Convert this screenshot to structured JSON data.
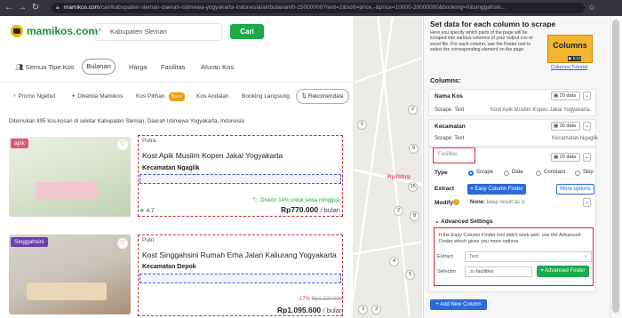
{
  "browser": {
    "url_domain": "mamikos.com",
    "url_rest": "/cari/kabupaten-sleman-daerah-istimewa-yogyakarta-indonesia/all/bulanan/0-15000000?rent=2&sort=price,-&price=10000-20000000&booking=0&singgahsin..."
  },
  "header": {
    "logo": "mamikos.com",
    "search_value": "Kabupaten Sleman",
    "search_button": "Cari"
  },
  "filters": {
    "tipe": "Semua Tipe Kos",
    "bulanan": "Bulanan",
    "harga": "Harga",
    "fasilitas": "Fasilitas",
    "aturan": "Aturan Kos"
  },
  "pills": {
    "promo": "Promo Ngebut",
    "dikelola": "Dikelola Mamikos",
    "pilihan": "Kos Pilihan",
    "baru": "Baru",
    "andalan": "Kos Andalan",
    "booking": "Booking Langsung",
    "rekomendasi": "Rekomendasi"
  },
  "found_text": "Ditemukan 895 kos-kosan di sekitar Kabupaten Sleman, Daerah Istimewa Yogyakarta, Indonesia",
  "listings": [
    {
      "tag": "apik",
      "gender": "Putra",
      "title": "Kost Apik Muslim Kopen Jakal Yogyakarta",
      "kecamatan": "Kecamatan Ngaglik",
      "discount": "Diskon 14% untuk sewa minggua",
      "rating": "4.7",
      "price": "Rp770.000",
      "per": "/ bulan"
    },
    {
      "tag": "Singgahsini",
      "gender": "Putri",
      "title": "Kost Singgahsini Rumah Erha Jalan Kaliurang Yogyakarta",
      "kecamatan": "Kecamatan Depok",
      "discount_pct": "17%",
      "old_price": "Rp1.320.000",
      "price": "Rp1.095.600",
      "per": "/ bulan"
    }
  ],
  "map": {
    "pins": [
      "2",
      "5",
      "9",
      "15",
      "2",
      "8",
      "4",
      "5",
      "3",
      "3"
    ],
    "label": "Rp700rb"
  },
  "panel": {
    "title": "Set data for each column to scrape",
    "description": "Here you specify which parts of the page will be scraped into various columns of your output csv or excel file. For each column, use the Finder tool to select the corresponding element on the page",
    "video_title": "Columns",
    "video_time": "5:13",
    "video_link": "Columns Tutorial",
    "columns_label": "Columns:",
    "col1": {
      "name": "Nama Kos",
      "count": "20 data",
      "scrape_label": "Scrape: Text",
      "scrape_value": "Kost Apik Muslim Kopen Jakal Yogyakarta"
    },
    "col2": {
      "name": "Kecamatan",
      "count": "20 data",
      "scrape_label": "Scrape: Text",
      "scrape_value": "Kecamatan Ngaglik"
    },
    "col3": {
      "name": "Fasilitas",
      "count": "20 data",
      "type_label": "Type",
      "types": [
        "Scrape",
        "Date",
        "Constant",
        "Skip"
      ],
      "extract_label": "Extract",
      "easy_finder": "Easy Column Finder",
      "more_options": "More options",
      "modify_label": "Modify",
      "modify_value": "None:",
      "modify_keep": "keep result as is",
      "advanced_label": "Advanced Settings",
      "advanced_text": "If the Easy Column Finder tool didn't work well, use the Advanced Finder which gives you more options.",
      "extract2_label": "Extract",
      "extract2_value": "Text",
      "selector_label": "Selector",
      "selector_value": ".rc-facilities",
      "advanced_finder": "Advanced Finder"
    },
    "add_column": "Add New Column"
  }
}
